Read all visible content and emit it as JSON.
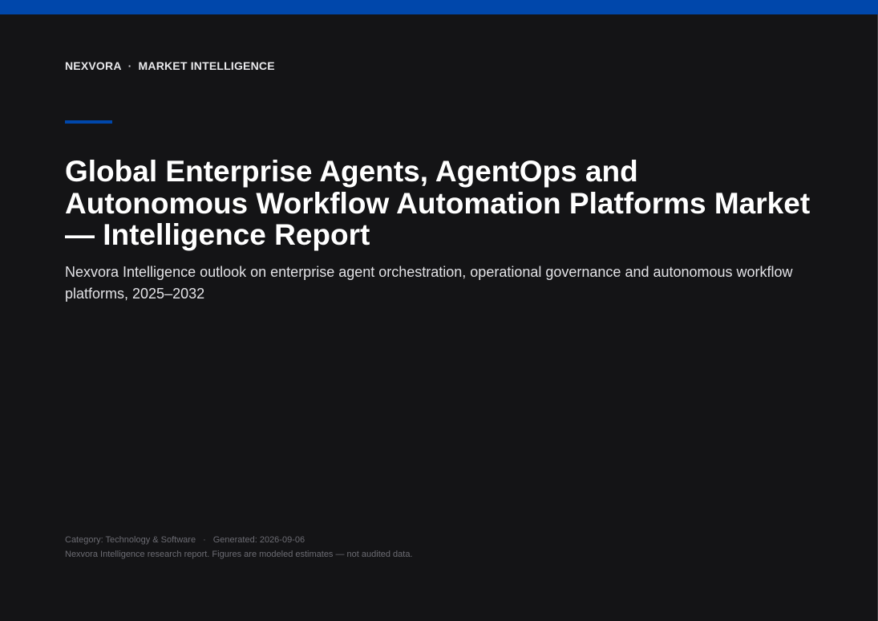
{
  "header": {
    "brand": "NEXVORA",
    "separator": "·",
    "section": "MARKET INTELLIGENCE"
  },
  "report": {
    "title": "Global Enterprise Agents, AgentOps and Autonomous Workflow Automation Platforms Market — Intelligence Report",
    "subtitle": "Nexvora Intelligence outlook on enterprise agent orchestration, operational governance and autonomous workflow platforms, 2025–2032"
  },
  "footer": {
    "category": "Category: Technology & Software",
    "separator": "·",
    "generated": "Generated: 2026-09-06",
    "disclaimer": "Nexvora Intelligence research report. Figures are modeled estimates — not audited data."
  },
  "colors": {
    "background": "#141416",
    "accent": "#0047ab",
    "text": "#ffffff",
    "muted": "#6c6c73"
  }
}
